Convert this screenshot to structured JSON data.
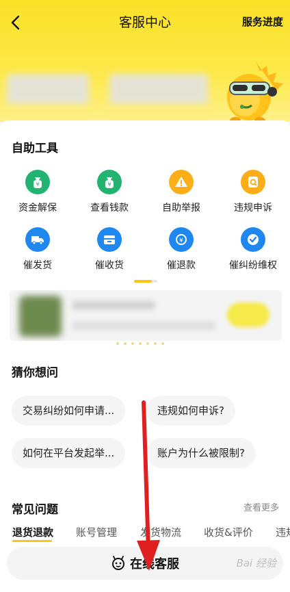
{
  "header": {
    "title": "客服中心",
    "progress_label": "服务进度",
    "icons": {
      "back": "chevron-left-icon",
      "mascot": "mascot-illustration"
    }
  },
  "self_service": {
    "title": "自助工具",
    "tools": [
      {
        "label": "资金解保",
        "icon": "money-bag-icon",
        "color": "#21b36f"
      },
      {
        "label": "查看钱款",
        "icon": "money-bag-icon",
        "color": "#21b36f"
      },
      {
        "label": "自助举报",
        "icon": "warning-icon",
        "color": "#fbae18"
      },
      {
        "label": "违规申诉",
        "icon": "search-doc-icon",
        "color": "#fbae18"
      },
      {
        "label": "催发货",
        "icon": "truck-icon",
        "color": "#1e88f0"
      },
      {
        "label": "催收货",
        "icon": "package-icon",
        "color": "#1e88f0"
      },
      {
        "label": "催退款",
        "icon": "refund-icon",
        "color": "#1e88f0"
      },
      {
        "label": "催纠纷维权",
        "icon": "check-icon",
        "color": "#1e88f0"
      }
    ]
  },
  "guess": {
    "title": "猜你想问",
    "questions": [
      "交易纠纷如何申请...",
      "违规如何申诉?",
      "如何在平台发起举...",
      "账户为什么被限制?"
    ]
  },
  "faq": {
    "title": "常见问题",
    "more_label": "查看更多",
    "tabs": [
      "退货退款",
      "账号管理",
      "发货物流",
      "收货&评价",
      "违规"
    ],
    "active_tab": "退货退款"
  },
  "online_service": {
    "label": "在线客服",
    "icon": "service-face-icon"
  },
  "watermark": "Bai 经验",
  "colors": {
    "brand_yellow": "#fbe127",
    "accent": "#ffc515",
    "annotation_arrow": "#e02020"
  }
}
